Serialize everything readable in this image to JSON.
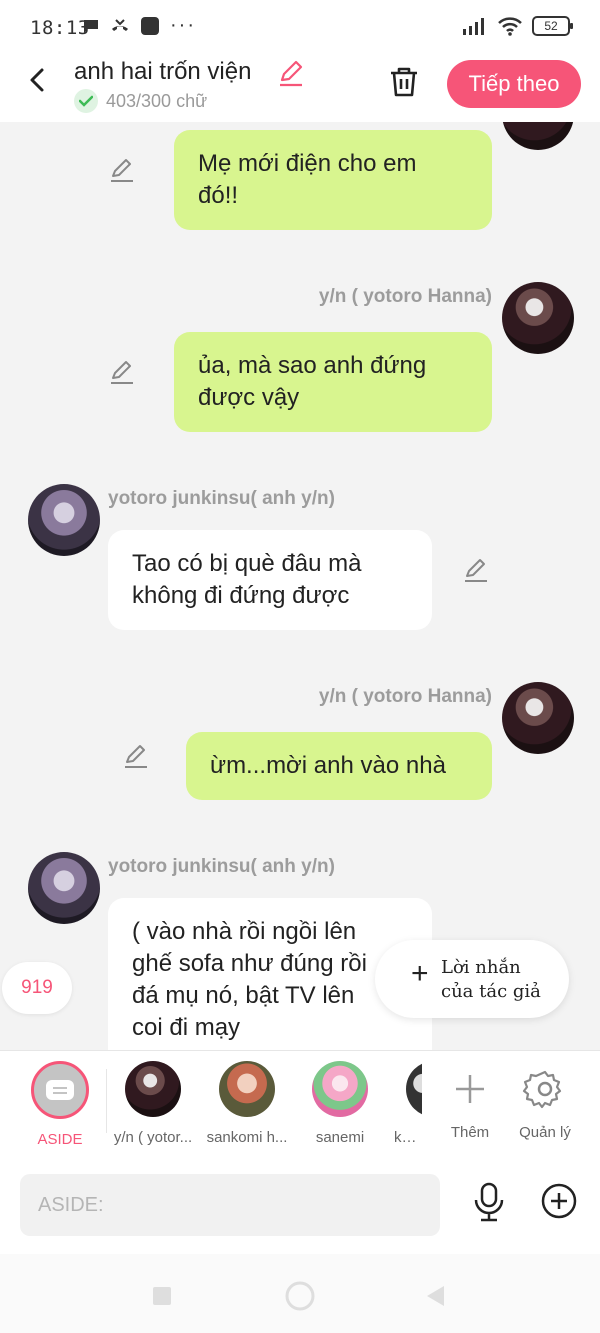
{
  "status_bar": {
    "time": "18:13",
    "dots": "···",
    "battery": "52"
  },
  "header": {
    "title": "anh hai trốn viện",
    "word_count": "403/300 chữ",
    "next_label": "Tiếp theo"
  },
  "messages": [
    {
      "sender": "",
      "text_line1": "Mẹ mới điện cho em",
      "text_line2": "đó!!"
    },
    {
      "sender": "y/n ( yotoro Hanna)",
      "text_line1": "ủa, mà sao anh đứng",
      "text_line2": "được vậy"
    },
    {
      "sender": "yotoro junkinsu( anh y/n)",
      "text_line1": "Tao có bị què đâu mà",
      "text_line2": "không đi đứng được"
    },
    {
      "sender": "y/n ( yotoro Hanna)",
      "text_line1": "ừm...mời anh vào nhà"
    },
    {
      "sender": "yotoro junkinsu( anh y/n)",
      "text_line1": "( vào nhà rồi ngồi lên",
      "text_line2": "ghế sofa như đúng rồi",
      "text_line3": "đá mụ nó, bật TV lên",
      "text_line4": "coi đi mạy"
    }
  ],
  "floating": {
    "count": "919",
    "author_note_line1": "Lời nhắn",
    "author_note_line2": "của tác giả"
  },
  "characters": {
    "aside_label": "ASIDE",
    "items": [
      "y/n ( yotor...",
      "sankomi h...",
      "sanemi",
      "kata"
    ],
    "more_label": "Thêm",
    "manage_label": "Quản lý"
  },
  "composer": {
    "placeholder": "ASIDE:"
  },
  "colors": {
    "accent": "#f65578",
    "my_bubble": "#d8f58f",
    "their_bubble": "#ffffff",
    "background": "#f3f3f3"
  }
}
